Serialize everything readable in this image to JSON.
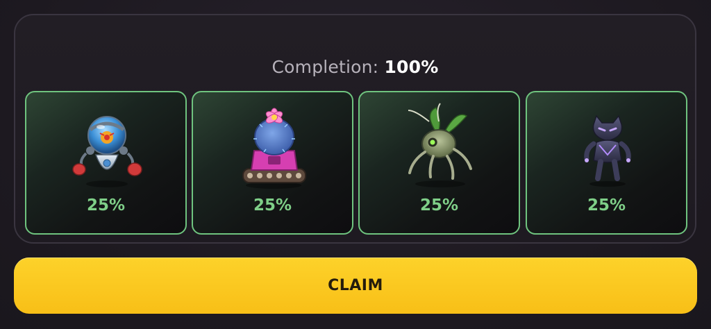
{
  "completion": {
    "label": "Completion:",
    "value": "100%"
  },
  "cards": [
    {
      "name": "robot-fish-mech",
      "icon": "robot-icon",
      "percent": "25%",
      "share": 0.25
    },
    {
      "name": "cactus-tank",
      "icon": "cactus-tank-icon",
      "percent": "25%",
      "share": 0.25
    },
    {
      "name": "bug-drone",
      "icon": "bug-drone-icon",
      "percent": "25%",
      "share": 0.25
    },
    {
      "name": "panther-warrior",
      "icon": "panther-icon",
      "percent": "25%",
      "share": 0.25
    }
  ],
  "claim_button": {
    "label": "CLAIM"
  },
  "colors": {
    "accent_green": "#7fcf88",
    "card_border": "#6fc47f",
    "claim_yellow": "#fbc81f",
    "background": "#1f1b22"
  }
}
